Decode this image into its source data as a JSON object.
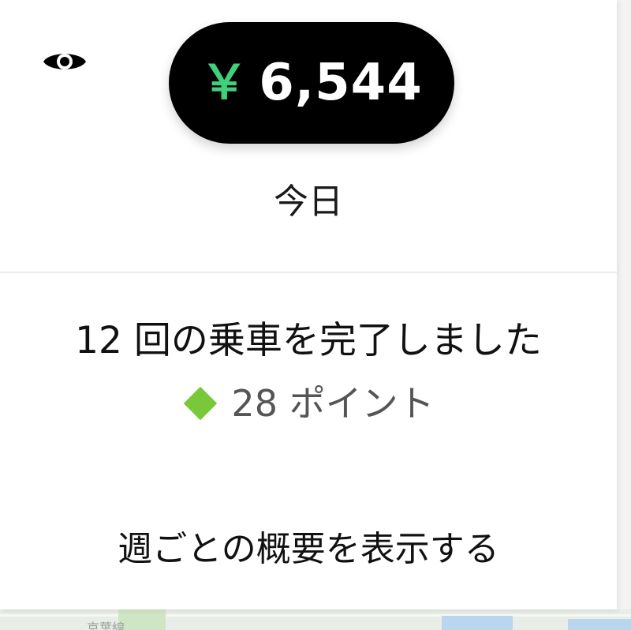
{
  "earnings": {
    "currency_symbol": "￥",
    "amount": "6,544",
    "period_label": "今日",
    "currency_color": "#3fd07c"
  },
  "summary": {
    "trips_text": "12 回の乗車を完了しました",
    "points_text": "28 ポイント",
    "points_icon": "diamond-icon",
    "points_icon_color": "#78c83a"
  },
  "actions": {
    "weekly_summary_label": "週ごとの概要を表示する"
  },
  "icons": {
    "visibility_toggle": "eye-icon"
  },
  "map": {
    "visible_text": "京葉線"
  }
}
